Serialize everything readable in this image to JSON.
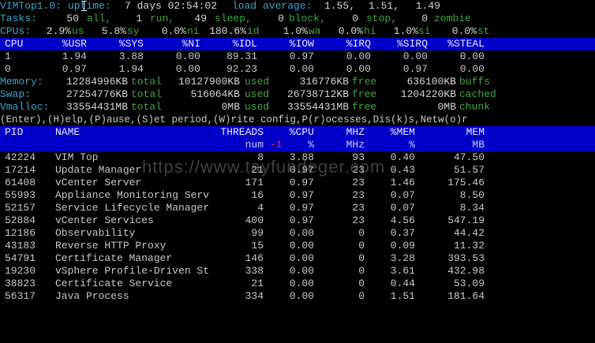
{
  "summary": {
    "app_label": "VIMTop1.0:",
    "uptime_label": "uptime:",
    "uptime_value": "7 days 02:54:02",
    "load_label": "load average:",
    "load_values": [
      "1.55,",
      "1.51,",
      "1.49"
    ],
    "tasks_label": "Tasks:",
    "tasks": [
      {
        "v": "50",
        "l": "all,"
      },
      {
        "v": "1",
        "l": "run,"
      },
      {
        "v": "49",
        "l": "sleep,"
      },
      {
        "v": "0",
        "l": "block,"
      },
      {
        "v": "0",
        "l": "stop,"
      },
      {
        "v": "0",
        "l": "zombie"
      }
    ],
    "cpus_label": "CPUs:",
    "cpus": [
      {
        "v": "2.9%",
        "l": "us"
      },
      {
        "v": "5.8%",
        "l": "sy"
      },
      {
        "v": "0.0%",
        "l": "ni"
      },
      {
        "v": "180.6%",
        "l": "id"
      },
      {
        "v": "1.0%",
        "l": "wa"
      },
      {
        "v": "0.0%",
        "l": "hi"
      },
      {
        "v": "1.0%",
        "l": "si"
      },
      {
        "v": "0.0%",
        "l": "st"
      }
    ]
  },
  "cpu_table": {
    "headers": [
      "CPU",
      "%USR",
      "%SYS",
      "%NI",
      "%IDL",
      "%IOW",
      "%IRQ",
      "%SIRQ",
      "%STEAL"
    ],
    "rows": [
      [
        "1",
        "1.94",
        "3.88",
        "0.00",
        "89.31",
        "0.97",
        "0.00",
        "0.00",
        "0.00"
      ],
      [
        "0",
        "0.97",
        "1.94",
        "0.00",
        "92.23",
        "0.00",
        "0.00",
        "0.97",
        "0.00"
      ]
    ]
  },
  "memory": {
    "memory_label": "Memory:",
    "memory_total": "12284996KB",
    "memory_total_l": "total",
    "memory_used": "10127900KB",
    "memory_used_l": "used",
    "memory_free": "316776KB",
    "memory_free_l": "free",
    "memory_buffs": "636100KB",
    "memory_buffs_l": "buffs",
    "swap_label": "Swap:",
    "swap_total": "27254776KB",
    "swap_total_l": "total",
    "swap_used": "516064KB",
    "swap_used_l": "used",
    "swap_free": "26738712KB",
    "swap_free_l": "free",
    "swap_cached": "1204220KB",
    "swap_cached_l": "cached",
    "vmalloc_label": "Vmalloc:",
    "vmalloc_total": "33554431MB",
    "vmalloc_total_l": "total",
    "vmalloc_used": "0MB",
    "vmalloc_used_l": "used",
    "vmalloc_free": "33554431MB",
    "vmalloc_free_l": "free",
    "vmalloc_chunk": "0MB",
    "vmalloc_chunk_l": "chunk"
  },
  "help_line": "(Enter),(H)elp,(P)ause,(S)et period,(W)rite config,P(r)ocesses,Dis(k)s,Netw(o)r",
  "process_table": {
    "headers": {
      "pid": "PID",
      "name": "NAME",
      "threads": "THREADS",
      "cpu": "%CPU",
      "mhz": "MHZ",
      "mem_pct": "%MEM",
      "mem": "MEM"
    },
    "subheaders": {
      "threads": "num",
      "sort": "-1",
      "cpu": "%",
      "mhz": "MHz",
      "mem_pct": "%",
      "mem": "MB"
    },
    "rows": [
      {
        "pid": "42224",
        "name": "VIM Top",
        "threads": "8",
        "cpu": "3.88",
        "mhz": "93",
        "mem_pct": "0.40",
        "mem": "47.50"
      },
      {
        "pid": "17214",
        "name": "Update Manager",
        "threads": "21",
        "cpu": "0.97",
        "mhz": "23",
        "mem_pct": "0.43",
        "mem": "51.57"
      },
      {
        "pid": "61408",
        "name": "vCenter Server",
        "threads": "171",
        "cpu": "0.97",
        "mhz": "23",
        "mem_pct": "1.46",
        "mem": "175.46"
      },
      {
        "pid": "55993",
        "name": "Appliance Monitoring Serv",
        "threads": "16",
        "cpu": "0.97",
        "mhz": "23",
        "mem_pct": "0.07",
        "mem": "8.50"
      },
      {
        "pid": "52157",
        "name": "Service Lifecycle Manager",
        "threads": "4",
        "cpu": "0.97",
        "mhz": "23",
        "mem_pct": "0.07",
        "mem": "8.34"
      },
      {
        "pid": "52884",
        "name": "vCenter Services",
        "threads": "400",
        "cpu": "0.97",
        "mhz": "23",
        "mem_pct": "4.56",
        "mem": "547.19"
      },
      {
        "pid": "12186",
        "name": "Observability",
        "threads": "99",
        "cpu": "0.00",
        "mhz": "0",
        "mem_pct": "0.37",
        "mem": "44.42"
      },
      {
        "pid": "43183",
        "name": "Reverse HTTP Proxy",
        "threads": "15",
        "cpu": "0.00",
        "mhz": "0",
        "mem_pct": "0.09",
        "mem": "11.32"
      },
      {
        "pid": "54791",
        "name": "Certificate Manager",
        "threads": "146",
        "cpu": "0.00",
        "mhz": "0",
        "mem_pct": "3.28",
        "mem": "393.53"
      },
      {
        "pid": "19230",
        "name": "vSphere Profile-Driven St",
        "threads": "338",
        "cpu": "0.00",
        "mhz": "0",
        "mem_pct": "3.61",
        "mem": "432.98"
      },
      {
        "pid": "38823",
        "name": "Certificate Service",
        "threads": "21",
        "cpu": "0.00",
        "mhz": "0",
        "mem_pct": "0.44",
        "mem": "53.09"
      },
      {
        "pid": "56317",
        "name": "Java Process",
        "threads": "334",
        "cpu": "0.00",
        "mhz": "0",
        "mem_pct": "1.51",
        "mem": "181.64"
      }
    ]
  },
  "watermark": "https://www.tayfundeger.com",
  "colors": {
    "header_bg": "#0000c8",
    "label": "#3aa6c8",
    "unit": "#3fa83f",
    "sort_marker": "#e03030"
  }
}
